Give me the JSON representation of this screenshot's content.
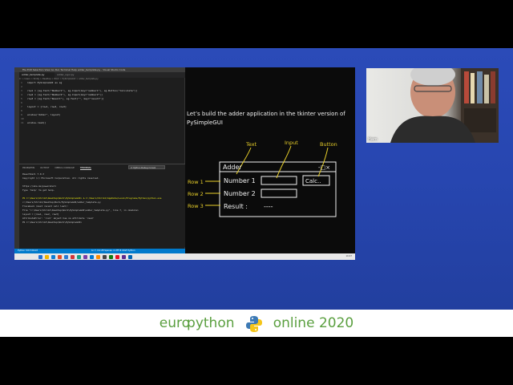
{
  "vscode": {
    "menu": "File  Edit  Selection  View  Go  Run  Terminal  Help      adder_template.py - Visual Studio Code",
    "tabs": [
      "adder_template.py",
      "adder_ngui.py"
    ],
    "breadcrumb": "C: > Users > ShrikJ > Desktop > Work > PySimpleGUI > adder_template.py",
    "code": [
      {
        "n": "1",
        "text": "import PySimpleGUI as sg"
      },
      {
        "n": "2",
        "text": ""
      },
      {
        "n": "3",
        "text": "row1 = [sg.Text(\"Number1\"), sg.Input(key=\"number1\"), sg.Button(\"Calculate\")]"
      },
      {
        "n": "4",
        "text": "row2 = [sg.Text(\"Number2\"), sg.Input(key=\"number2\")]"
      },
      {
        "n": "5",
        "text": "row3 = [sg.Text(\"Result\"), sg.Text(\"\", key=\"result\")]"
      },
      {
        "n": "6",
        "text": ""
      },
      {
        "n": "7",
        "text": "layout = [row1, row2, row3]"
      },
      {
        "n": "8",
        "text": ""
      },
      {
        "n": "9",
        "text": "window(\"Adder\", layout)"
      },
      {
        "n": "10",
        "text": ""
      },
      {
        "n": "11",
        "text": "window.read()"
      }
    ],
    "panel_tabs": [
      "PROBLEMS",
      "OUTPUT",
      "DEBUG CONSOLE",
      "TERMINAL"
    ],
    "terminal_dropdown": "2: Python Debug Consol",
    "terminal": [
      {
        "text": "PowerShell 7.0.3",
        "color": "#cccccc"
      },
      {
        "text": "Copyright (c) Microsoft Corporation. All rights reserved.",
        "color": "#cccccc"
      },
      {
        "text": "",
        "color": "#cccccc"
      },
      {
        "text": "https://aka.ms/powershell",
        "color": "#cccccc"
      },
      {
        "text": "Type 'help' to get help.",
        "color": "#cccccc"
      },
      {
        "text": "",
        "color": "#cccccc"
      },
      {
        "text": "PS C:\\Users\\ShrikJ\\Desktop\\Work\\PySimpleGUI>  & C:/Users/ShrikJ/AppData/Local/Programs/Python/python.exe",
        "color": "#e5e510"
      },
      {
        "text": "c:/Users/ShrikJ/Desktop/Work/PySimpleGUI/adder_template.py",
        "color": "#cccccc"
      },
      {
        "text": "Traceback (most recent call last):",
        "color": "#cccccc"
      },
      {
        "text": "  File \"c:\\Users\\ShrikJ\\Desktop\\Work\\PySimpleGUI\\adder_template.py\", line 7, in <module>",
        "color": "#cccccc"
      },
      {
        "text": "    layout = [row1, row2, row3]",
        "color": "#cccccc"
      },
      {
        "text": "AttributeError: 'list' object has no attribute 'read'",
        "color": "#cccccc"
      },
      {
        "text": "PS C:\\Users\\ShrikJ\\Desktop\\Work\\PySimpleGUI>",
        "color": "#cccccc"
      }
    ],
    "status_left": "Python 3.8.5 64-bit",
    "status_right": "Ln 7, Col 28   Spaces: 4   UTF-8   CRLF   Python"
  },
  "whiteboard": {
    "intro": "Let’s build the adder application in the tkinter version of PySimpleGUI",
    "annotations": {
      "text": "Text",
      "input": "Input",
      "button": "Button"
    },
    "window_title": "Adder",
    "window_controls": "-□×",
    "rows": [
      "Number 1",
      "Number 2",
      "Result :"
    ],
    "result_value": "----",
    "button_label": "Calc..",
    "row_labels": [
      "Row 1",
      "Row 2",
      "Row 3"
    ]
  },
  "taskbar": {
    "time": "10:47",
    "icon_colors": [
      "#1f6fd6",
      "#f2b400",
      "#0f7dd4",
      "#e34c26",
      "#2b7bd3",
      "#d13438",
      "#16a085",
      "#7a3ea8",
      "#0078d4",
      "#ff8c00",
      "#444444",
      "#107c10",
      "#e81123",
      "#5c2d91",
      "#0063b1"
    ]
  },
  "webcam": {
    "name": "Ham"
  },
  "banner": {
    "euro": "euro",
    "python": "python",
    "online": "online 2020",
    "corner": " "
  }
}
